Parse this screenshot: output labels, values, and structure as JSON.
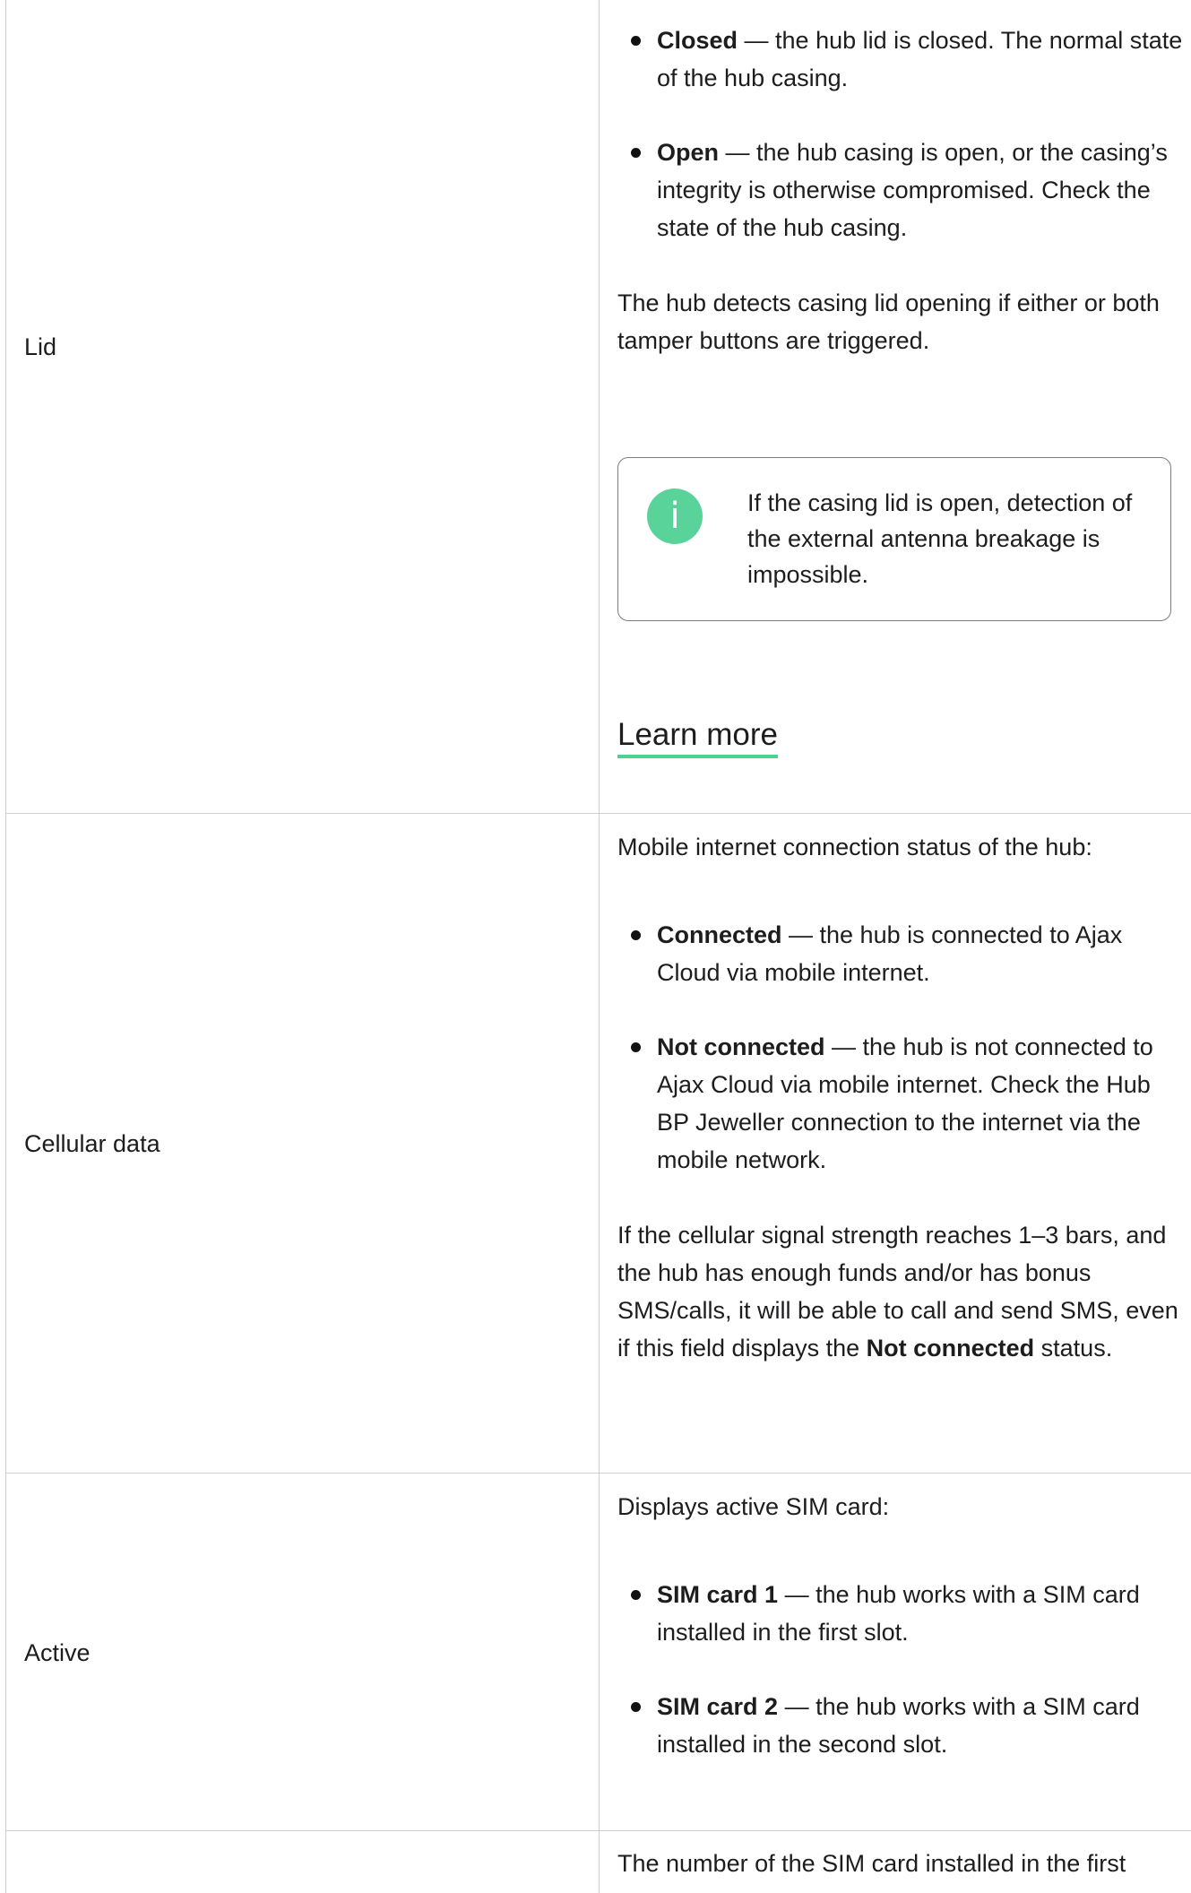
{
  "lid_row": {
    "name": "Lid",
    "bullets": [
      {
        "term": "Closed",
        "text": " — the hub lid is closed. The normal state of the hub casing."
      },
      {
        "term": "Open",
        "text": " — the hub casing is open, or the casing’s integrity is otherwise compromised. Check the state of the hub casing."
      }
    ],
    "paragraph": "The hub detects casing lid opening if either or both tamper buttons are triggered.",
    "note": {
      "icon": "info-icon",
      "icon_glyph": "i",
      "text": "If the casing lid is open, detection of the external antenna breakage is impossible."
    },
    "learn_more": "Learn more"
  },
  "cellular_row": {
    "name": "Cellular data",
    "intro": "Mobile internet connection status of the hub:",
    "bullets": [
      {
        "term": "Connected",
        "text": " — the hub is connected to Ajax Cloud via mobile internet."
      },
      {
        "term": "Not connected",
        "text": " — the hub is not connected to Ajax Cloud via mobile internet. Check the Hub BP Jeweller connection to the internet via the mobile network."
      }
    ],
    "paragraph_pre": "If the cellular signal strength reaches 1–3 bars, and the hub has enough funds and/or has bonus SMS/calls, it will be able to call and send SMS, even if this field displays the ",
    "paragraph_bold": "Not connected",
    "paragraph_post": " status."
  },
  "active_row": {
    "name": "Active",
    "intro": "Displays active SIM card:",
    "bullets": [
      {
        "term": "SIM card 1",
        "text": " — the hub works with a SIM card installed in the first slot."
      },
      {
        "term": "SIM card 2",
        "text": " — the hub works with a SIM card installed in the second slot."
      }
    ]
  },
  "next_row": {
    "intro": "The number of the SIM card installed in the first"
  },
  "colors": {
    "accent_green": "#5ad39a",
    "border": "#cfcfd3"
  }
}
